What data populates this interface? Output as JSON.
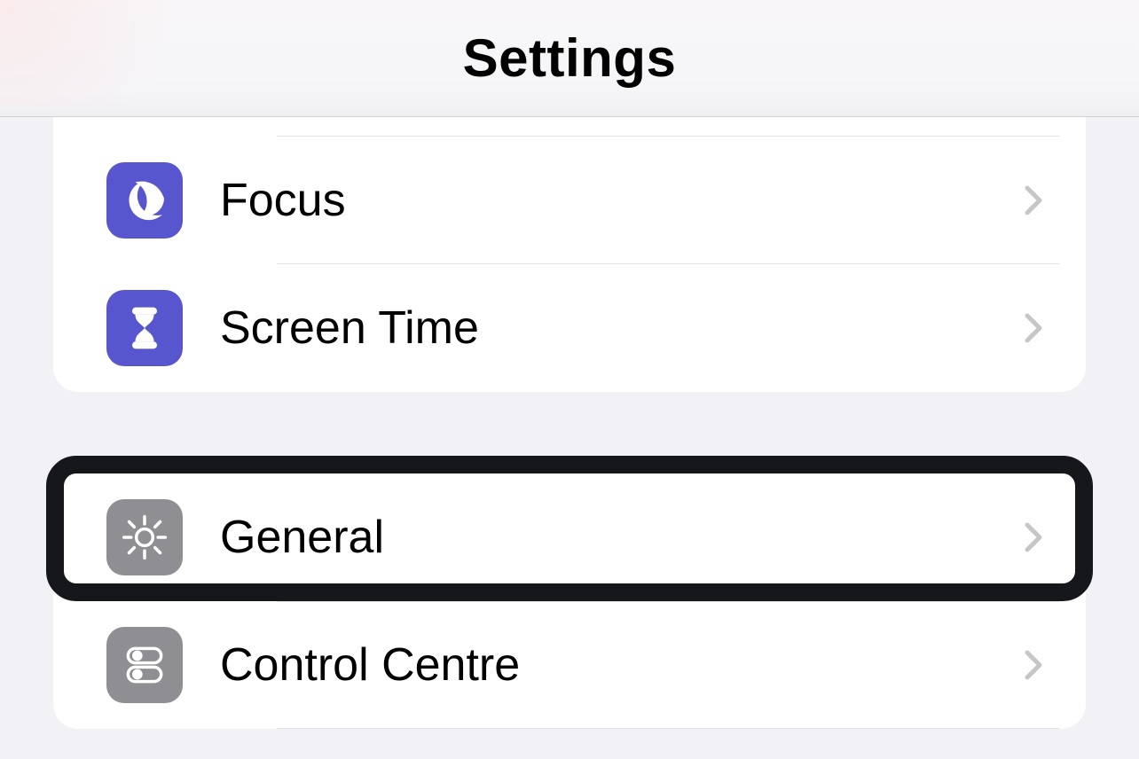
{
  "header": {
    "title": "Settings"
  },
  "groups": [
    {
      "rows": [
        {
          "id": "focus",
          "label": "Focus",
          "icon": "moon-icon",
          "color": "#5856ce"
        },
        {
          "id": "screen-time",
          "label": "Screen Time",
          "icon": "hourglass-icon",
          "color": "#5856ce"
        }
      ]
    },
    {
      "rows": [
        {
          "id": "general",
          "label": "General",
          "icon": "gear-icon",
          "color": "#8e8e93",
          "highlighted": true
        },
        {
          "id": "control-centre",
          "label": "Control Centre",
          "icon": "toggles-icon",
          "color": "#8e8e93"
        }
      ]
    }
  ]
}
